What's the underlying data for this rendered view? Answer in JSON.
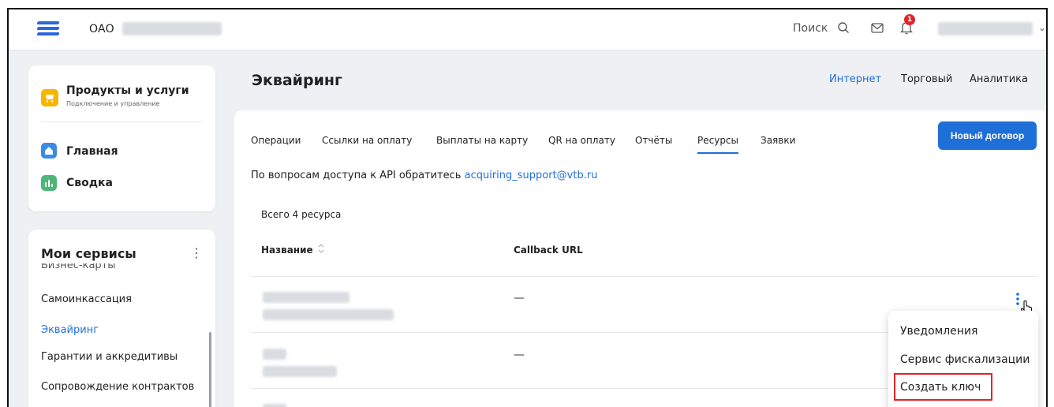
{
  "header": {
    "org_prefix": "ОАО",
    "search_label": "Поиск",
    "notifications_count": "1",
    "accent_color": "#1f6fd8"
  },
  "sidebar": {
    "products": {
      "title": "Продукты и услуги",
      "subtitle": "Подключение и управление"
    },
    "nav": [
      {
        "label": "Главная"
      },
      {
        "label": "Сводка"
      }
    ],
    "services": {
      "title": "Мои сервисы",
      "partial_item": "Бизнес-карты",
      "items": [
        {
          "label": "Самоинкассация"
        },
        {
          "label": "Эквайринг",
          "active": true
        },
        {
          "label": "Гарантии и аккредитивы"
        },
        {
          "label": "Сопровождение контрактов"
        }
      ]
    }
  },
  "main": {
    "title": "Эквайринг",
    "top_tabs": [
      {
        "label": "Интернет",
        "active": true
      },
      {
        "label": "Торговый"
      },
      {
        "label": "Аналитика"
      }
    ],
    "tabs": [
      {
        "label": "Операции"
      },
      {
        "label": "Ссылки на оплату"
      },
      {
        "label": "Выплаты на карту"
      },
      {
        "label": "QR на оплату"
      },
      {
        "label": "Отчёты"
      },
      {
        "label": "Ресурсы",
        "active": true
      },
      {
        "label": "Заявки"
      }
    ],
    "new_contract_button": "Новый договор",
    "api_text": "По вопросам доступа к API обратитесь",
    "api_email": "acquiring_support@vtb.ru",
    "count_text": "Всего 4 ресурса",
    "columns": [
      "Название",
      "Callback URL"
    ],
    "rows": [
      {
        "callback": "—"
      },
      {
        "callback": "—"
      },
      {
        "callback": "—"
      }
    ]
  },
  "context_menu": {
    "items": [
      {
        "label": "Уведомления"
      },
      {
        "label": "Сервис фискализации"
      },
      {
        "label": "Создать ключ",
        "highlighted": true
      }
    ]
  }
}
